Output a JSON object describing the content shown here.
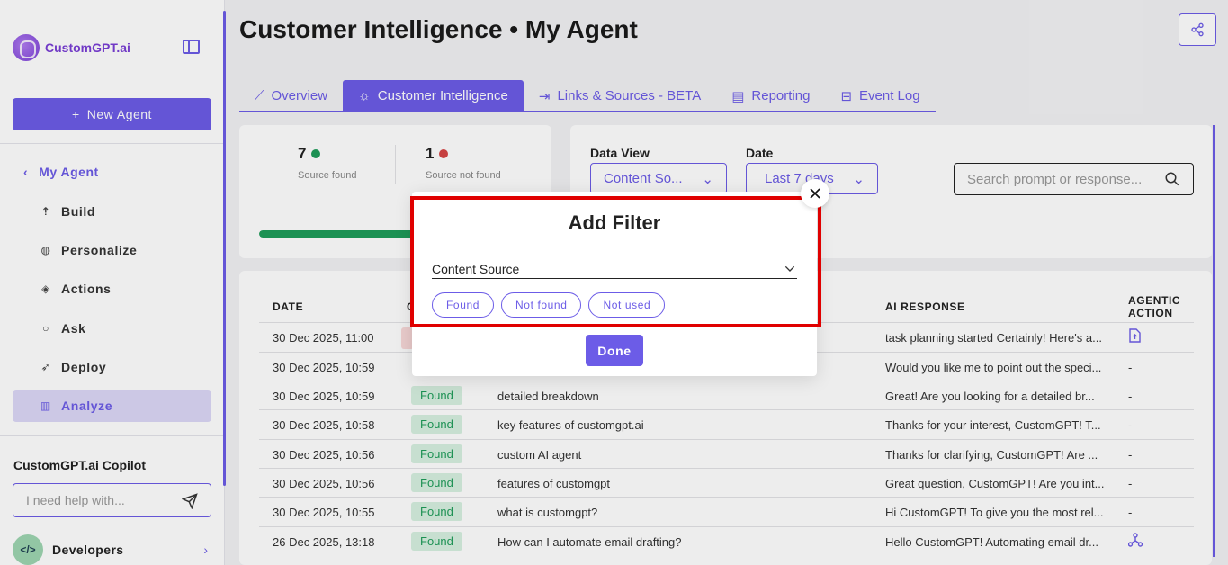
{
  "app": {
    "logo_text": "CustomGPT.ai"
  },
  "sidebar": {
    "new_agent_label": "New Agent",
    "back_label": "My Agent",
    "items": [
      {
        "label": "Build",
        "icon": "build-icon"
      },
      {
        "label": "Personalize",
        "icon": "palette-icon"
      },
      {
        "label": "Actions",
        "icon": "actions-icon"
      },
      {
        "label": "Ask",
        "icon": "chat-icon"
      },
      {
        "label": "Deploy",
        "icon": "rocket-icon"
      },
      {
        "label": "Analyze",
        "icon": "chart-icon",
        "active": true
      }
    ],
    "copilot_title": "CustomGPT.ai Copilot",
    "copilot_placeholder": "I need help with...",
    "developers_label": "Developers",
    "developers_avatar": "</>"
  },
  "header": {
    "title": "Customer Intelligence • My Agent"
  },
  "tabs": [
    {
      "label": "Overview",
      "icon": "trend-icon"
    },
    {
      "label": "Customer Intelligence",
      "icon": "bulb-icon",
      "active": true
    },
    {
      "label": "Links & Sources - BETA",
      "icon": "exit-icon"
    },
    {
      "label": "Reporting",
      "icon": "report-icon"
    },
    {
      "label": "Event Log",
      "icon": "archive-icon"
    }
  ],
  "stats": {
    "found_count": "7",
    "found_label": "Source found",
    "not_found_count": "1",
    "not_found_label": "Source not found",
    "progress_fraction": 0.875
  },
  "filters": {
    "data_view_label": "Data View",
    "data_view_value": "Content So...",
    "date_label": "Date",
    "date_value": "Last 7 days",
    "search_placeholder": "Search prompt or response..."
  },
  "table": {
    "headers": {
      "date": "DATE",
      "source": "C",
      "ai_response": "AI RESPONSE",
      "agentic_action_1": "AGENTIC",
      "agentic_action_2": "ACTION"
    },
    "rows": [
      {
        "date": "30 Dec 2025, 11:00",
        "status": "",
        "prompt": "",
        "response": "task planning started Certainly! Here's a...",
        "action": "file-upload-icon"
      },
      {
        "date": "30 Dec 2025, 10:59",
        "status": "",
        "prompt": "",
        "response": "Would you like me to point out the speci...",
        "action": "-"
      },
      {
        "date": "30 Dec 2025, 10:59",
        "status": "Found",
        "prompt": "detailed breakdown",
        "response": "Great! Are you looking for a detailed br...",
        "action": "-"
      },
      {
        "date": "30 Dec 2025, 10:58",
        "status": "Found",
        "prompt": "key features of customgpt.ai",
        "response": "Thanks for your interest, CustomGPT! T...",
        "action": "-"
      },
      {
        "date": "30 Dec 2025, 10:56",
        "status": "Found",
        "prompt": "custom AI agent",
        "response": "Thanks for clarifying, CustomGPT! Are ...",
        "action": "-"
      },
      {
        "date": "30 Dec 2025, 10:56",
        "status": "Found",
        "prompt": "features of customgpt",
        "response": "Great question, CustomGPT! Are you int...",
        "action": "-"
      },
      {
        "date": "30 Dec 2025, 10:55",
        "status": "Found",
        "prompt": "what is customgpt?",
        "response": "Hi CustomGPT! To give you the most rel...",
        "action": "-"
      },
      {
        "date": "26 Dec 2025, 13:18",
        "status": "Found",
        "prompt": "How can I automate email drafting?",
        "response": "Hello CustomGPT! Automating email dr...",
        "action": "network-icon"
      }
    ]
  },
  "modal": {
    "title": "Add Filter",
    "select_value": "Content Source",
    "options": [
      "Found",
      "Not found",
      "Not used"
    ],
    "done_label": "Done"
  },
  "colors": {
    "accent": "#6c5ce7",
    "success": "#1f9d5a",
    "danger": "#e00000"
  }
}
